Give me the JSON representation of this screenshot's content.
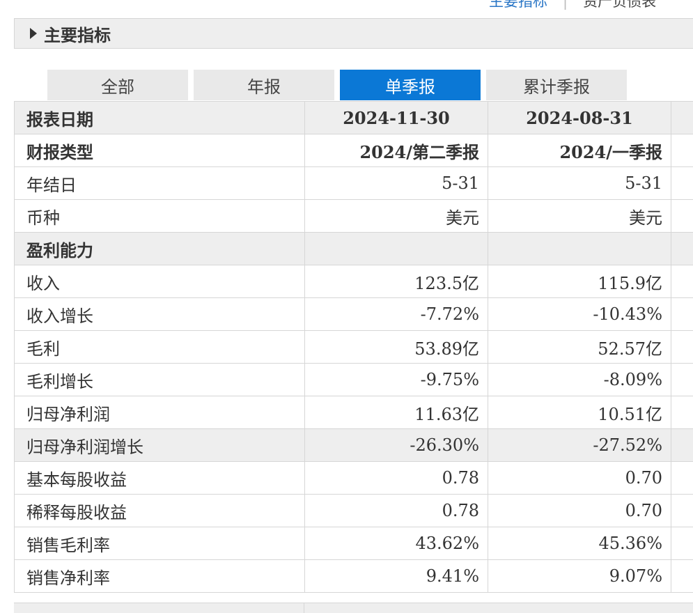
{
  "top_links": {
    "active": "主要指标",
    "other": "资产负债表"
  },
  "section": {
    "title": "主要指标"
  },
  "tabs": [
    "全部",
    "年报",
    "单季报",
    "累计季报"
  ],
  "active_tab": 2,
  "table": {
    "rows": [
      {
        "label": "报表日期",
        "values": [
          "2024-11-30",
          "2024-08-31"
        ],
        "style": "head"
      },
      {
        "label": "财报类型",
        "values": [
          "2024/第二季报",
          "2024/一季报"
        ],
        "style": "bold"
      },
      {
        "label": "年结日",
        "values": [
          "5-31",
          "5-31"
        ]
      },
      {
        "label": "币种",
        "values": [
          "美元",
          "美元"
        ]
      },
      {
        "label": "盈利能力",
        "values": [
          "",
          ""
        ],
        "style": "group"
      },
      {
        "label": "收入",
        "values": [
          "123.5亿",
          "115.9亿"
        ]
      },
      {
        "label": "收入增长",
        "values": [
          "-7.72%",
          "-10.43%"
        ]
      },
      {
        "label": "毛利",
        "values": [
          "53.89亿",
          "52.57亿"
        ]
      },
      {
        "label": "毛利增长",
        "values": [
          "-9.75%",
          "-8.09%"
        ]
      },
      {
        "label": "归母净利润",
        "values": [
          "11.63亿",
          "10.51亿"
        ]
      },
      {
        "label": "归母净利润增长",
        "values": [
          "-26.30%",
          "-27.52%"
        ],
        "style": "hl"
      },
      {
        "label": "基本每股收益",
        "values": [
          "0.78",
          "0.70"
        ]
      },
      {
        "label": "稀释每股收益",
        "values": [
          "0.78",
          "0.70"
        ]
      },
      {
        "label": "销售毛利率",
        "values": [
          "43.62%",
          "45.36%"
        ]
      },
      {
        "label": "销售净利率",
        "values": [
          "9.41%",
          "9.07%"
        ]
      }
    ]
  }
}
